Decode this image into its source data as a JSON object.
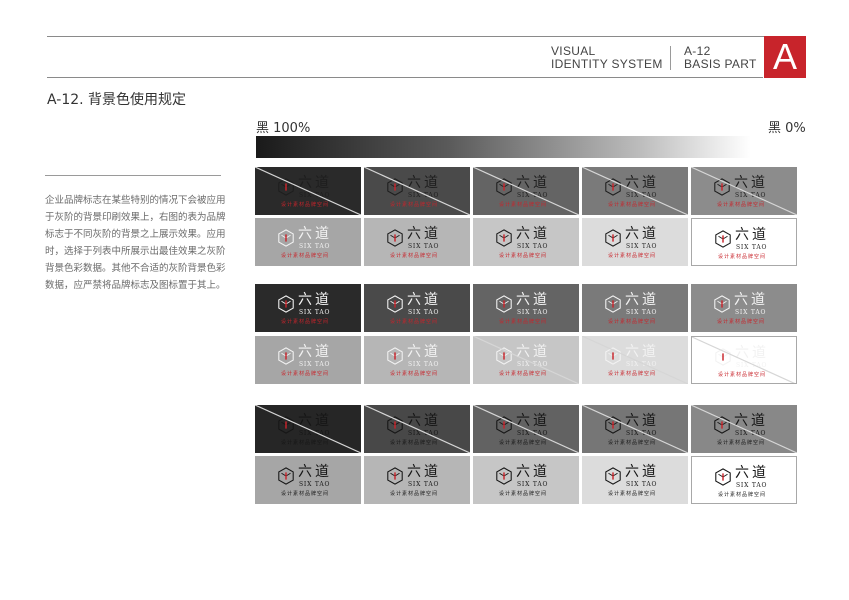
{
  "header": {
    "left_line1": "VISUAL",
    "left_line2": "IDENTITY SYSTEM",
    "right_line1": "A-12",
    "right_line2": "BASIS PART",
    "badge": "A",
    "accent_color": "#c8242b"
  },
  "page_title": "A-12. 背景色使用规定",
  "description": "企业品牌标志在某些特别的情况下会被应用于灰阶的背景印刷效果上，右图的表为品牌标志于不同灰阶的背景之上展示效果。应用时，选择于列表中所展示出最佳效果之灰阶背景色彩数据。其他不合适的灰阶背景色彩数据，应严禁将品牌标志及图标置于其上。",
  "gradient": {
    "left_label": "黑 100%",
    "right_label": "黑 0%",
    "from_color": "#1a1a1a",
    "to_color": "#ffffff"
  },
  "logo": {
    "cn": "六道",
    "en": "SIX TAO",
    "sub": "设计素材品牌空间",
    "icon": "hexagon-logo-icon",
    "red": "#c8242b"
  },
  "swatch_rows": [
    {
      "group": 1,
      "cells": [
        {
          "bg": "#2a2a2a",
          "logo": "dark",
          "valid": false
        },
        {
          "bg": "#4a4a4a",
          "logo": "dark",
          "valid": false
        },
        {
          "bg": "#646464",
          "logo": "dark",
          "valid": false
        },
        {
          "bg": "#7a7a7a",
          "logo": "dark",
          "valid": false
        },
        {
          "bg": "#8c8c8c",
          "logo": "dark",
          "valid": false
        }
      ]
    },
    {
      "group": 1,
      "cells": [
        {
          "bg": "#a6a6a6",
          "logo": "light",
          "valid": true
        },
        {
          "bg": "#b6b6b6",
          "logo": "dark",
          "valid": true
        },
        {
          "bg": "#c6c6c6",
          "logo": "dark",
          "valid": true
        },
        {
          "bg": "#dcdcdc",
          "logo": "dark",
          "valid": true
        },
        {
          "bg": "#ffffff",
          "logo": "dark",
          "valid": true
        }
      ]
    },
    {
      "group": 2,
      "cells": [
        {
          "bg": "#2a2a2a",
          "logo": "light",
          "valid": true
        },
        {
          "bg": "#4a4a4a",
          "logo": "light",
          "valid": true
        },
        {
          "bg": "#646464",
          "logo": "light",
          "valid": true
        },
        {
          "bg": "#7a7a7a",
          "logo": "light",
          "valid": true
        },
        {
          "bg": "#8c8c8c",
          "logo": "light",
          "valid": true
        }
      ]
    },
    {
      "group": 2,
      "cells": [
        {
          "bg": "#a6a6a6",
          "logo": "light",
          "valid": true
        },
        {
          "bg": "#b6b6b6",
          "logo": "light",
          "valid": true
        },
        {
          "bg": "#c6c6c6",
          "logo": "light",
          "valid": false
        },
        {
          "bg": "#dcdcdc",
          "logo": "light",
          "valid": false
        },
        {
          "bg": "#ffffff",
          "logo": "light",
          "valid": false
        }
      ]
    },
    {
      "group": 3,
      "cells": [
        {
          "bg": "#262626",
          "logo": "black",
          "valid": false
        },
        {
          "bg": "#484848",
          "logo": "black",
          "valid": false
        },
        {
          "bg": "#626262",
          "logo": "black",
          "valid": false
        },
        {
          "bg": "#767676",
          "logo": "black",
          "valid": false
        },
        {
          "bg": "#888888",
          "logo": "black",
          "valid": false
        }
      ]
    },
    {
      "group": 3,
      "cells": [
        {
          "bg": "#a6a6a6",
          "logo": "black",
          "valid": true
        },
        {
          "bg": "#b6b6b6",
          "logo": "black",
          "valid": true
        },
        {
          "bg": "#c6c6c6",
          "logo": "black",
          "valid": true
        },
        {
          "bg": "#dcdcdc",
          "logo": "black",
          "valid": true
        },
        {
          "bg": "#ffffff",
          "logo": "black",
          "valid": true
        }
      ]
    }
  ]
}
